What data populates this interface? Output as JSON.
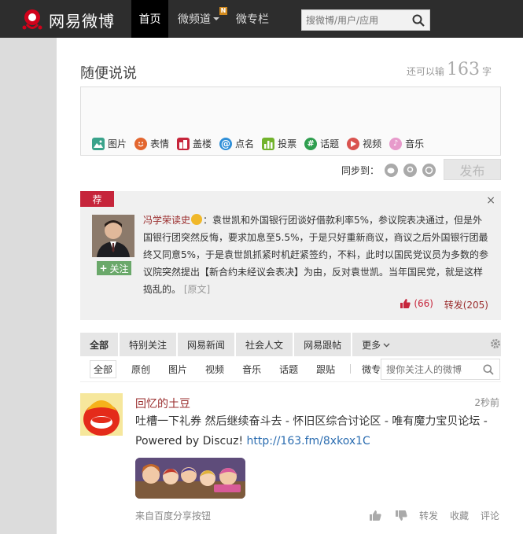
{
  "topbar": {
    "logo_text": "网易微博",
    "nav": {
      "home": "首页",
      "channel": "微频道",
      "channel_badge": "N",
      "column": "微专栏"
    },
    "search_placeholder": "搜微博/用户/应用"
  },
  "publisher": {
    "title": "随便说说",
    "count_prefix": "还可以输",
    "count_number": "163",
    "count_suffix": "字",
    "tools": [
      {
        "label": "图片",
        "icon": "image-icon",
        "color": "#3aa38b"
      },
      {
        "label": "表情",
        "icon": "emoji-icon",
        "color": "#e3662f"
      },
      {
        "label": "盖楼",
        "icon": "building-icon",
        "color": "#c6253b"
      },
      {
        "label": "点名",
        "icon": "at-icon",
        "color": "#2f8fd8"
      },
      {
        "label": "投票",
        "icon": "vote-icon",
        "color": "#72b32c"
      },
      {
        "label": "话题",
        "icon": "topic-icon",
        "color": "#2f9e4f"
      },
      {
        "label": "视频",
        "icon": "video-icon",
        "color": "#d9534f"
      },
      {
        "label": "音乐",
        "icon": "music-icon",
        "color": "#e79acb"
      }
    ],
    "sync_label": "同步到：",
    "post_label": "发布"
  },
  "recommend": {
    "tag": "荐",
    "close": "×",
    "follow_label": "关注",
    "author": "冯学荣读史",
    "text": "：袁世凯和外国银行团谈好借款利率5%，参议院表决通过，但是外国银行团突然反悔，要求加息至5.5%，于是只好重新商议，商议之后外国银行团最终又同意5%，于是袁世凯抓紧时机赶紧签约，不料，此时以国民党议员为多数的参议院突然提出【新合约未经议会表决】为由，反对袁世凯。当年国民党，就是这样捣乱的。",
    "origin_link": "[原文]",
    "likes": "(66)",
    "forward": "转发(205)"
  },
  "feed_tabs": {
    "tabs": [
      "全部",
      "特别关注",
      "网易新闻",
      "社会人文",
      "网易跟帖",
      "更多"
    ],
    "subtabs": [
      "全部",
      "原创",
      "图片",
      "视频",
      "音乐",
      "话题",
      "跟贴",
      "微专栏"
    ],
    "search_placeholder": "搜你关注人的微博"
  },
  "feed_item": {
    "name": "回忆的土豆",
    "time": "2秒前",
    "text": "吐槽一下礼券 然后继续奋斗去 - 怀旧区综合讨论区 - 唯有魔力宝贝论坛 - Powered by Discuz! ",
    "link": "http://163.fm/8xkox1C",
    "source": "来自百度分享按钮",
    "actions": {
      "forward": "转发",
      "favorite": "收藏",
      "comment": "评论"
    }
  }
}
